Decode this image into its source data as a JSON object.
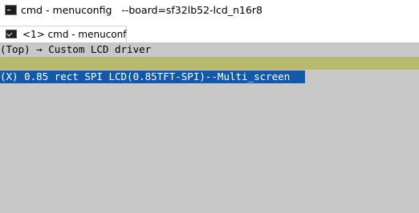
{
  "window": {
    "title": "cmd - menuconfig   --board=sf32lb52-lcd_n16r8",
    "app_icon": "console-icon"
  },
  "tab": {
    "label": "<1> cmd - menuconf",
    "icon": "console-icon"
  },
  "terminal": {
    "breadcrumb": "(Top) → Custom LCD driver",
    "selected_choice": "(X) 0.85 rect SPI LCD(0.85TFT-SPI)--Multi_screen",
    "colors": {
      "background": "#c8c8c8",
      "separator": "#b8b86e",
      "selection": "#1458a8"
    }
  }
}
